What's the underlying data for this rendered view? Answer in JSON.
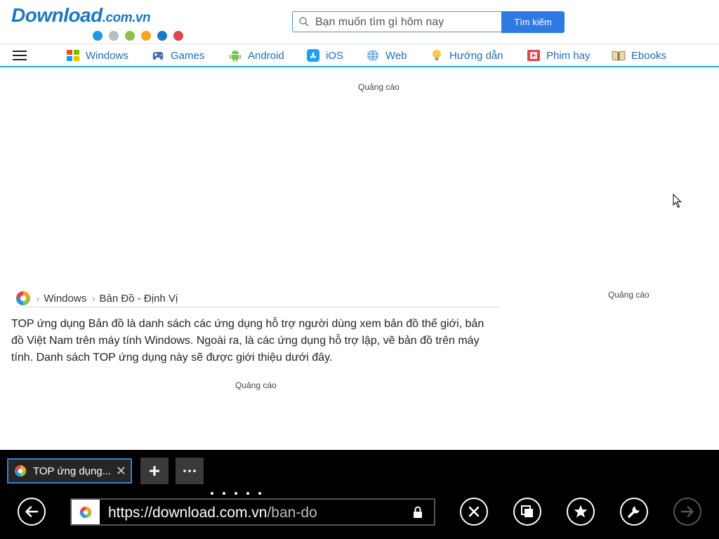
{
  "site": {
    "logo_main": "Download",
    "logo_domain": ".com.vn",
    "logo_dot_colors": [
      "#1e9be0",
      "#b9bcc2",
      "#8cc152",
      "#f5a623",
      "#1a78c2",
      "#e0454b"
    ],
    "search_placeholder": "Bạn muốn tìm gì hôm nay",
    "search_button": "Tìm kiếm"
  },
  "nav": {
    "items": [
      {
        "label": "Windows",
        "icon": "windows-icon"
      },
      {
        "label": "Games",
        "icon": "gamepad-icon"
      },
      {
        "label": "Android",
        "icon": "android-icon"
      },
      {
        "label": "iOS",
        "icon": "appstore-icon"
      },
      {
        "label": "Web",
        "icon": "globe-icon"
      },
      {
        "label": "Hướng dẫn",
        "icon": "lightbulb-icon"
      },
      {
        "label": "Phim hay",
        "icon": "film-icon"
      },
      {
        "label": "Ebooks",
        "icon": "book-icon"
      }
    ],
    "accent": "#27a8c9"
  },
  "content": {
    "ad_label": "Quảng cáo",
    "breadcrumb": [
      "Windows",
      "Bản Đồ - Định Vị"
    ],
    "intro": "TOP ứng dụng Bản đồ là danh sách các ứng dụng hỗ trợ người dùng xem bản đồ thế giới, bản đồ Việt Nam trên máy tính Windows. Ngoài ra, là các ứng dụng hỗ trợ lập, vẽ bản đồ trên máy tính. Danh sách TOP ứng dụng này sẽ được giới thiệu dưới đây."
  },
  "browser": {
    "tab_title": "TOP ứng dụng...",
    "url_host": "https://download.com.vn",
    "url_path": "/ban-do",
    "tab_border_color": "#3b7fd0"
  }
}
